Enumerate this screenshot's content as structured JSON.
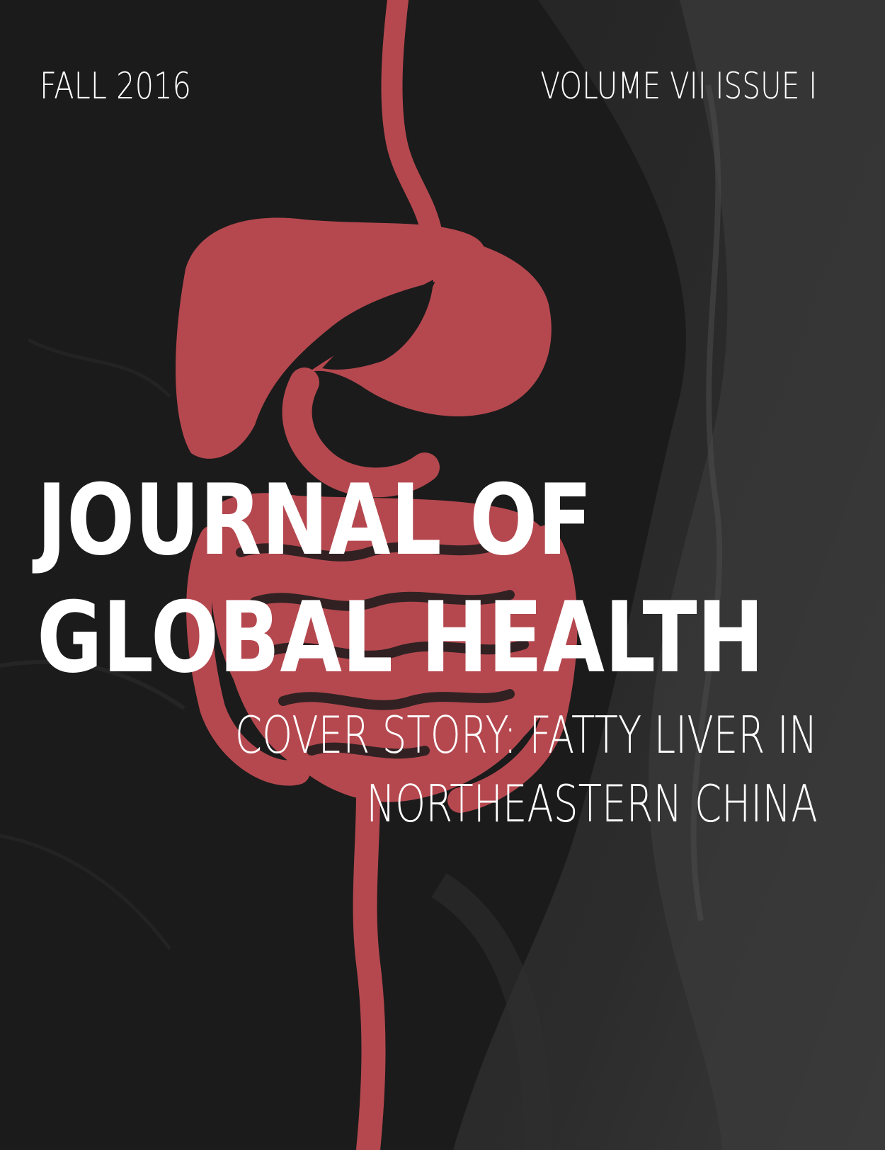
{
  "cover": {
    "issue_date": "FALL 2016",
    "issue_volume": "VOLUME VII ISSUE I",
    "title_line_1": "JOURNAL OF",
    "title_line_2": "GLOBAL HEALTH",
    "cover_story_line_1": "COVER STORY: FATTY LIVER IN",
    "cover_story_line_2": "NORTHEASTERN CHINA"
  },
  "colors": {
    "background": "#1c1c1c",
    "organ_red": "#b5484f",
    "text": "#ffffff"
  },
  "icons": {
    "illustration": "digestive-system-icon"
  }
}
